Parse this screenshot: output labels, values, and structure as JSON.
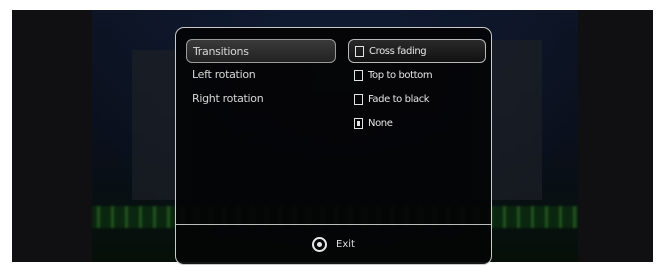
{
  "menu": {
    "items": [
      {
        "label": "Transitions",
        "selected": true
      },
      {
        "label": "Left rotation",
        "selected": false
      },
      {
        "label": "Right rotation",
        "selected": false
      }
    ]
  },
  "options": {
    "items": [
      {
        "label": "Cross fading",
        "checked": false,
        "focused": true
      },
      {
        "label": "Top to bottom",
        "checked": false,
        "focused": false
      },
      {
        "label": "Fade to black",
        "checked": false,
        "focused": false
      },
      {
        "label": "None",
        "checked": true,
        "focused": false
      }
    ]
  },
  "footer": {
    "exit_label": "Exit",
    "exit_icon": "circle-button-icon"
  }
}
